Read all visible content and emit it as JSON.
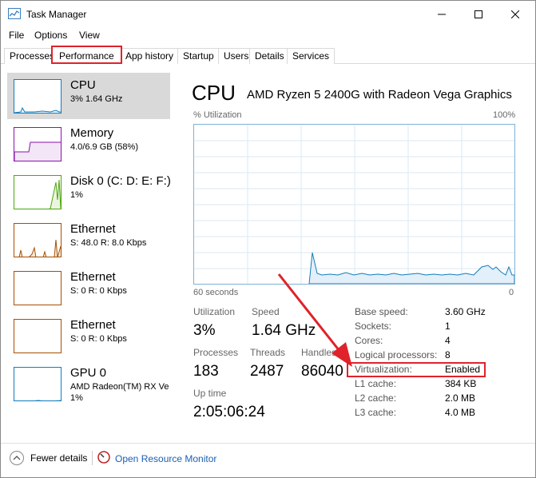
{
  "window": {
    "title": "Task Manager"
  },
  "menu": [
    "File",
    "Options",
    "View"
  ],
  "tabs": [
    "Processes",
    "Performance",
    "App history",
    "Startup",
    "Users",
    "Details",
    "Services"
  ],
  "sidebar": [
    {
      "title": "CPU",
      "sub": "3% 1.64 GHz",
      "sub2": ""
    },
    {
      "title": "Memory",
      "sub": "4.0/6.9 GB (58%)",
      "sub2": ""
    },
    {
      "title": "Disk 0 (C: D: E: F:)",
      "sub": "1%",
      "sub2": ""
    },
    {
      "title": "Ethernet",
      "sub": "S: 48.0  R: 8.0 Kbps",
      "sub2": ""
    },
    {
      "title": "Ethernet",
      "sub": "S: 0  R: 0 Kbps",
      "sub2": ""
    },
    {
      "title": "Ethernet",
      "sub": "S: 0  R: 0 Kbps",
      "sub2": ""
    },
    {
      "title": "GPU 0",
      "sub": "AMD Radeon(TM) RX Ve",
      "sub2": "1%"
    }
  ],
  "main": {
    "title": "CPU",
    "model": "AMD Ryzen 5 2400G with Radeon Vega Graphics",
    "graph_top_left": "% Utilization",
    "graph_top_right": "100%",
    "graph_bottom_left": "60 seconds",
    "graph_bottom_right": "0",
    "stats": {
      "utilization_label": "Utilization",
      "utilization_value": "3%",
      "speed_label": "Speed",
      "speed_value": "1.64 GHz",
      "processes_label": "Processes",
      "processes_value": "183",
      "threads_label": "Threads",
      "threads_value": "2487",
      "handles_label": "Handles",
      "handles_value": "86040",
      "uptime_label": "Up time",
      "uptime_value": "2:05:06:24"
    },
    "details": [
      {
        "label": "Base speed:",
        "value": "3.60 GHz"
      },
      {
        "label": "Sockets:",
        "value": "1"
      },
      {
        "label": "Cores:",
        "value": "4"
      },
      {
        "label": "Logical processors:",
        "value": "8"
      },
      {
        "label": "Virtualization:",
        "value": "Enabled"
      },
      {
        "label": "L1 cache:",
        "value": "384 KB"
      },
      {
        "label": "L2 cache:",
        "value": "2.0 MB"
      },
      {
        "label": "L3 cache:",
        "value": "4.0 MB"
      }
    ]
  },
  "footer": {
    "fewer_details": "Fewer details",
    "resource_monitor": "Open Resource Monitor"
  },
  "colors": {
    "cpu": "#117dbb",
    "memory": "#8b12ae",
    "disk": "#4da60c",
    "ethernet": "#a74f01",
    "gpu": "#117dbb",
    "highlight": "#e0222a"
  }
}
